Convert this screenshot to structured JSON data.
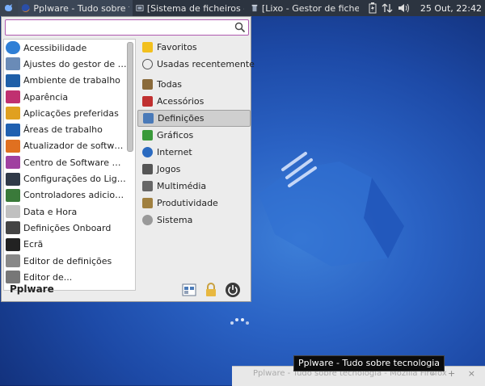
{
  "panel": {
    "tasks": [
      {
        "label": "Pplware - Tudo sobre tec...",
        "icon": "firefox-icon"
      },
      {
        "label": "[Sistema de ficheiros - G...",
        "icon": "folder-icon"
      },
      {
        "label": "[Lixo - Gestor de ficheiros]",
        "icon": "trash-icon"
      }
    ],
    "clock": "25 Out, 22:42"
  },
  "menu": {
    "search": {
      "value": "",
      "placeholder": ""
    },
    "apps": [
      {
        "label": "Acessibilidade",
        "color": "#2f7fd6"
      },
      {
        "label": "Ajustes do gestor de janelas",
        "color": "#6a8bb7"
      },
      {
        "label": "Ambiente de trabalho",
        "color": "#1f5fa8"
      },
      {
        "label": "Aparência",
        "color": "#c03070"
      },
      {
        "label": "Aplicações preferidas",
        "color": "#e0a020"
      },
      {
        "label": "Áreas de trabalho",
        "color": "#2060b0"
      },
      {
        "label": "Atualizador de software",
        "color": "#e07020"
      },
      {
        "label": "Centro de Software Ubuntu",
        "color": "#a040a0"
      },
      {
        "label": "Configurações do Light Locker",
        "color": "#303a48"
      },
      {
        "label": "Controladores adicionais",
        "color": "#3a7a3a"
      },
      {
        "label": "Data e Hora",
        "color": "#c0c0c0"
      },
      {
        "label": "Definições Onboard",
        "color": "#444444"
      },
      {
        "label": "Ecrã",
        "color": "#222222"
      },
      {
        "label": "Editor de definições",
        "color": "#888888"
      },
      {
        "label": "Editor de...",
        "color": "#777777"
      }
    ],
    "categories": [
      {
        "label": "Favoritos",
        "color": "#f2c01e"
      },
      {
        "label": "Usadas recentemente",
        "color": "#555555"
      },
      {
        "label": "Todas",
        "color": "#8a6a3a"
      },
      {
        "label": "Acessórios",
        "color": "#c03030"
      },
      {
        "label": "Definições",
        "color": "#4a7ab8"
      },
      {
        "label": "Gráficos",
        "color": "#3a9a3a"
      },
      {
        "label": "Internet",
        "color": "#2a6ac0"
      },
      {
        "label": "Jogos",
        "color": "#555555"
      },
      {
        "label": "Multimédia",
        "color": "#666666"
      },
      {
        "label": "Produtividade",
        "color": "#a08040"
      },
      {
        "label": "Sistema",
        "color": "#999999"
      }
    ],
    "selected_category": "Definições",
    "user": "Pplware"
  },
  "tooltip": "Pplware - Tudo sobre tecnologia",
  "window": {
    "title": "Pplware - Tudo sobre tecnologia - Mozilla Firefox",
    "controls": "– + ×"
  }
}
